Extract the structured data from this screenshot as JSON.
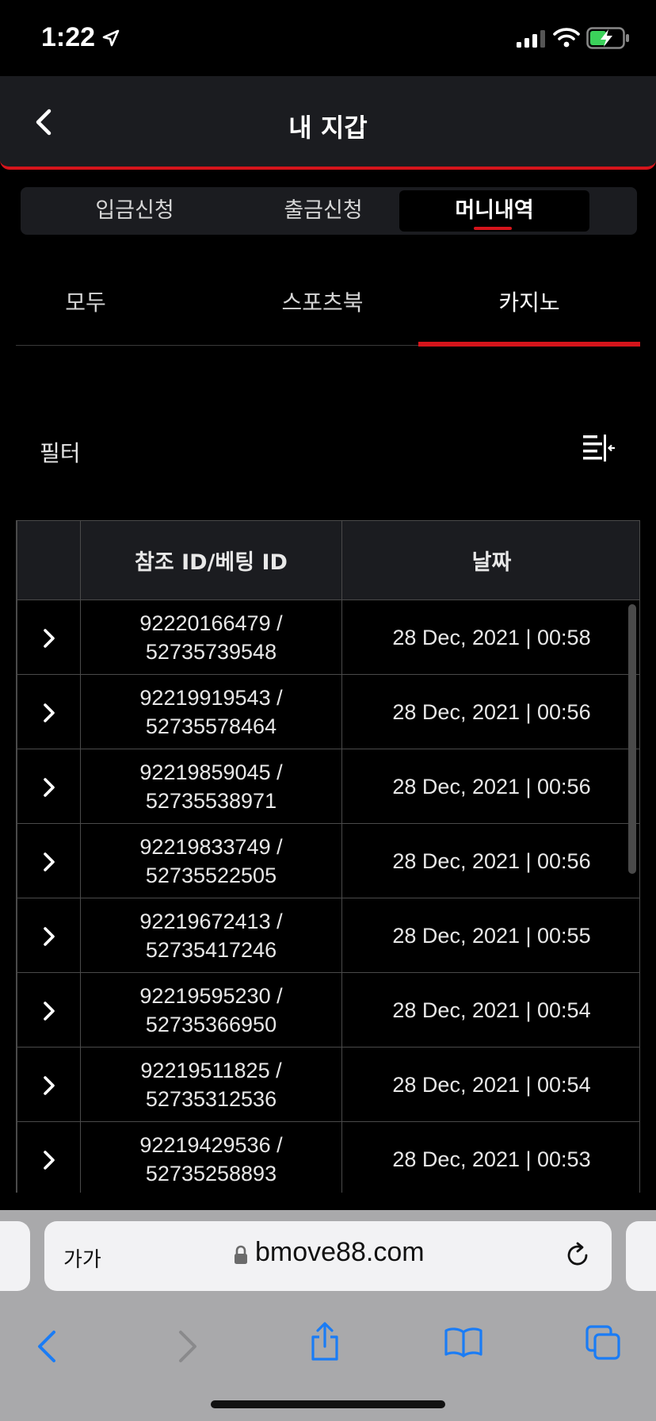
{
  "status_bar": {
    "time": "1:22"
  },
  "header": {
    "title": "내 지갑"
  },
  "wallet_tabs": [
    {
      "label": "입금신청",
      "active": false
    },
    {
      "label": "출금신청",
      "active": false
    },
    {
      "label": "머니내역",
      "active": true
    }
  ],
  "sub_tabs": [
    {
      "label": "모두",
      "active": false
    },
    {
      "label": "스포츠북",
      "active": false
    },
    {
      "label": "카지노",
      "active": true
    }
  ],
  "filter": {
    "label": "필터"
  },
  "table": {
    "columns": [
      "",
      "참조 ID/베팅 ID",
      "날짜"
    ],
    "rows": [
      {
        "ref_id": "92220166479 /",
        "bet_id": "52735739548",
        "date": "28 Dec, 2021 | 00:58"
      },
      {
        "ref_id": "92219919543 /",
        "bet_id": "52735578464",
        "date": "28 Dec, 2021 | 00:56"
      },
      {
        "ref_id": "92219859045 /",
        "bet_id": "52735538971",
        "date": "28 Dec, 2021 | 00:56"
      },
      {
        "ref_id": "92219833749 /",
        "bet_id": "52735522505",
        "date": "28 Dec, 2021 | 00:56"
      },
      {
        "ref_id": "92219672413 /",
        "bet_id": "52735417246",
        "date": "28 Dec, 2021 | 00:55"
      },
      {
        "ref_id": "92219595230 /",
        "bet_id": "52735366950",
        "date": "28 Dec, 2021 | 00:54"
      },
      {
        "ref_id": "92219511825 /",
        "bet_id": "52735312536",
        "date": "28 Dec, 2021 | 00:54"
      },
      {
        "ref_id": "92219429536 /",
        "bet_id": "52735258893",
        "date": "28 Dec, 2021 | 00:53"
      }
    ]
  },
  "browser": {
    "text_size_label": "가가",
    "url": "bmove88.com"
  },
  "colors": {
    "accent": "#d5141b",
    "header_bg": "#1b1c20",
    "ios_blue": "#1a7cf5"
  }
}
